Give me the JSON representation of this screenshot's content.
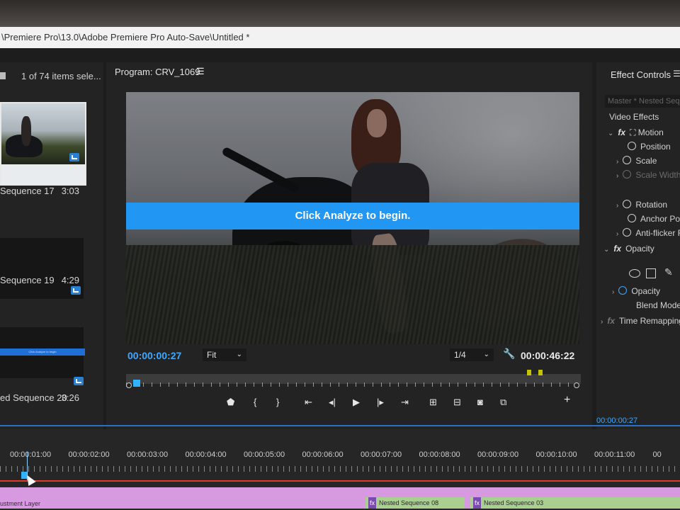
{
  "window": {
    "title": "\\Premiere Pro\\13.0\\Adobe Premiere Pro Auto-Save\\Untitled *"
  },
  "project_panel": {
    "selection_status": "1 of 74 items sele...",
    "items": [
      {
        "name": "Sequence 17",
        "duration": "3:03"
      },
      {
        "name": "Sequence 19",
        "duration": "4:29"
      },
      {
        "name": "ed Sequence 20",
        "duration": "3:26"
      }
    ],
    "thumb_banner_text": "Click Analyze to begin"
  },
  "program_monitor": {
    "title": "Program: CRV_1069",
    "overlay_message": "Click Analyze to begin.",
    "current_timecode": "00:00:00:27",
    "zoom": "Fit",
    "resolution": "1/4",
    "total_timecode": "00:00:46:22",
    "playhead_fraction": 0.01
  },
  "effect_controls": {
    "title": "Effect Controls",
    "source": "Master * Nested Sequ",
    "section": "Video Effects",
    "rows": [
      {
        "label": "Motion"
      },
      {
        "label": "Position"
      },
      {
        "label": "Scale"
      },
      {
        "label": "Scale Width"
      },
      {
        "label": "Rotation"
      },
      {
        "label": "Anchor Point"
      },
      {
        "label": "Anti-flicker F"
      },
      {
        "label": "Opacity"
      },
      {
        "label": "Opacity"
      },
      {
        "label": "Blend Mode"
      },
      {
        "label": "Time Remapping"
      }
    ],
    "timecode": "00:00:00:27"
  },
  "timeline": {
    "ruler_labels": [
      "00:00:01:00",
      "00:00:02:00",
      "00:00:03:00",
      "00:00:04:00",
      "00:00:05:00",
      "00:00:06:00",
      "00:00:07:00",
      "00:00:08:00",
      "00:00:09:00",
      "00:00:10:00",
      "00:00:11:00",
      "00"
    ],
    "adjustment_clip": "ustment Layer",
    "nested_clips": [
      "Nested Sequence 08",
      "Nested Sequence 03"
    ]
  },
  "colors": {
    "accent_blue": "#2196f3",
    "timecode_blue": "#3ea8ff",
    "timeline_red": "#e23a2a",
    "track_pink": "#d79ae0",
    "clip_green": "#a9d08f"
  }
}
